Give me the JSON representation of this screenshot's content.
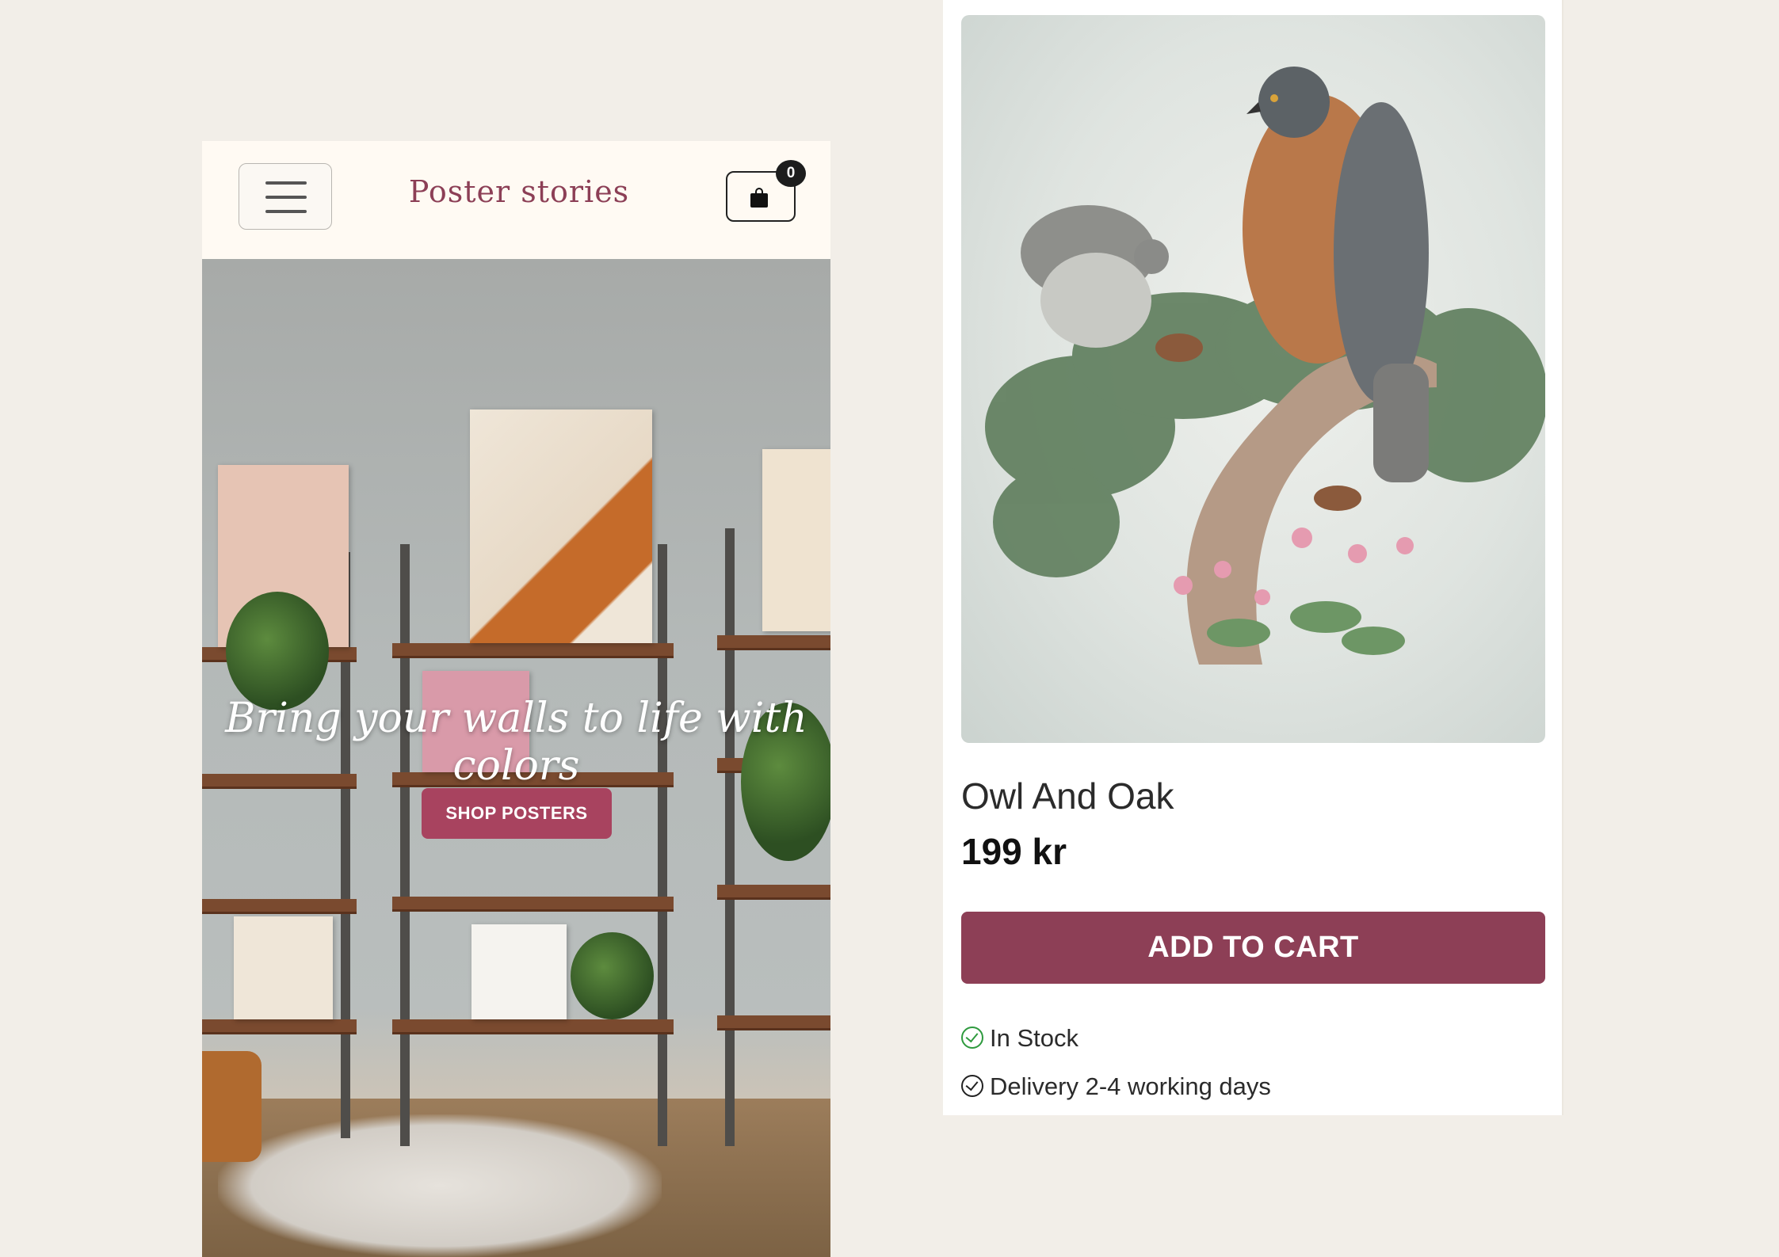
{
  "header": {
    "logo_text": "Poster stories",
    "cart_count": "0",
    "menu_icon": "hamburger-menu-icon",
    "cart_icon": "shopping-bag-icon"
  },
  "hero": {
    "title": "Bring your walls to life with colors",
    "button_label": "SHOP POSTERS"
  },
  "product": {
    "title": "Owl And Oak",
    "price": "199 kr",
    "add_to_cart_label": "ADD TO CART",
    "stock_status": "In Stock",
    "delivery_info": "Delivery 2-4 working days",
    "stock_icon": "check-circle-icon"
  },
  "colors": {
    "brand": "#8d3f56",
    "hero_button": "#a8435f",
    "page_background": "#f2eee8",
    "in_stock_green": "#2e9a3e"
  }
}
